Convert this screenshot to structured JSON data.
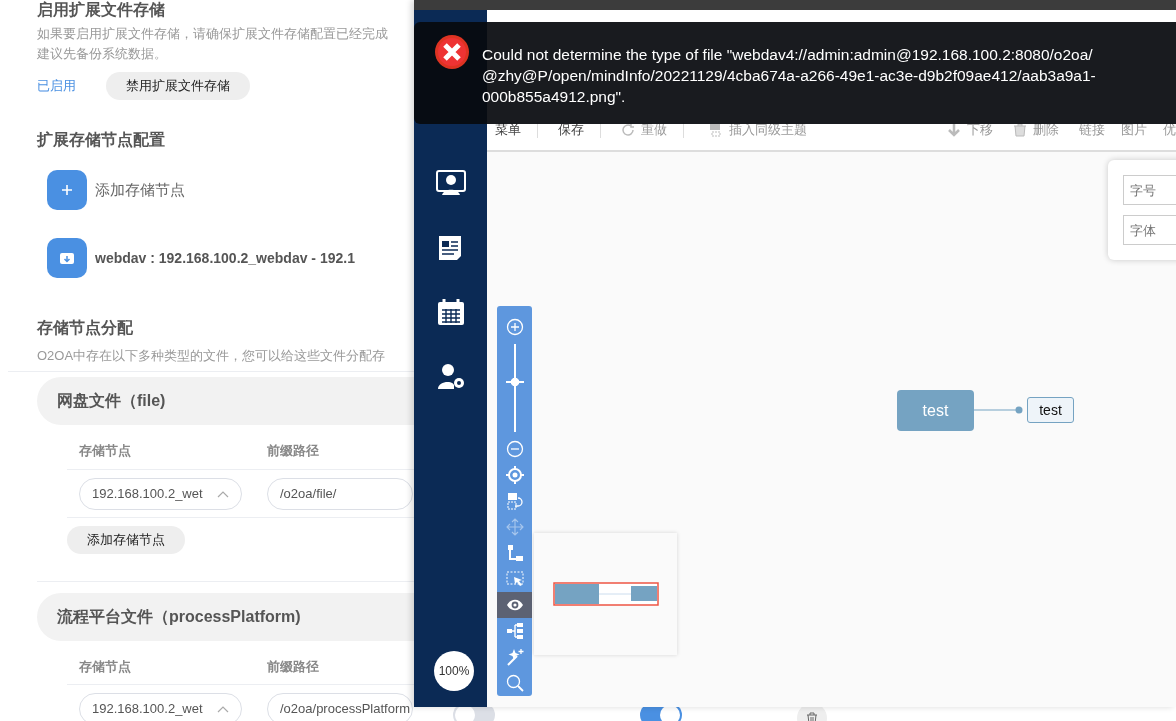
{
  "background_page": {
    "enable_section": {
      "title": "启用扩展文件存储",
      "description_lines": [
        "如果要启用扩展文件存储，请确保扩展文件存储配置已经完成",
        "建议先备份系统数据。"
      ],
      "status": "已启用",
      "button": "禁用扩展文件存储"
    },
    "node_config": {
      "title": "扩展存储节点配置",
      "add_label": "添加存储节点",
      "nodes": [
        "webdav : 192.168.100.2_webdav - 192.1"
      ]
    },
    "assignment": {
      "title": "存储节点分配",
      "description": "O2OA中存在以下多种类型的文件，您可以给这些文件分配存",
      "groups": [
        {
          "title": "网盘文件（file)",
          "columns": [
            "存储节点",
            "前缀路径"
          ],
          "rows": [
            {
              "node": "192.168.100.2_wet",
              "prefix": "/o2oa/file/"
            }
          ],
          "add_button": "添加存储节点"
        },
        {
          "title": "流程平台文件（processPlatform)",
          "columns": [
            "存储节点",
            "前缀路径"
          ],
          "rows": [
            {
              "node": "192.168.100.2_wet",
              "prefix": "/o2oa/processPlatform",
              "toggles": [
                {
                  "on": false
                },
                {
                  "on": true
                }
              ]
            }
          ]
        }
      ]
    }
  },
  "window": {
    "toolbar": [
      {
        "label": "菜单",
        "disabled": false
      },
      {
        "label": "保存",
        "disabled": false
      },
      {
        "label": "重做",
        "disabled": true
      },
      {
        "label": "插入同级主题",
        "disabled": true
      },
      {
        "label": "下移",
        "disabled": true
      },
      {
        "label": "删除",
        "disabled": true
      },
      {
        "label": "链接",
        "disabled": true
      },
      {
        "label": "图片",
        "disabled": true
      },
      {
        "label": "优",
        "disabled": true
      }
    ],
    "zoom_slider": {
      "level": 0.6
    },
    "zoom_tools": [
      {
        "selected": false,
        "disabled": false
      },
      {
        "selected": false,
        "disabled": false
      },
      {
        "selected": false,
        "disabled": false
      },
      {
        "selected": false,
        "disabled": false
      },
      {
        "selected": false,
        "disabled": true
      },
      {
        "selected": false,
        "disabled": false
      },
      {
        "selected": false,
        "disabled": false
      },
      {
        "selected": true,
        "disabled": false
      },
      {
        "selected": false,
        "disabled": false
      },
      {
        "selected": false,
        "disabled": false
      },
      {
        "selected": false,
        "disabled": false
      }
    ],
    "zoom_label": "100%",
    "mind_map": {
      "root": "test",
      "children": [
        "test"
      ]
    },
    "format_panel": {
      "fields": [
        {
          "placeholder": "字号"
        },
        {
          "placeholder": "字体"
        }
      ]
    },
    "error_toast": {
      "lines": [
        "Could not determine the type of file \"webdav4://admin:admin@192.168.100.2:8080/o2oa/",
        "@zhy@P/open/mindInfo/20221129/4cba674a-a266-49e1-ac3e-d9b2f09ae412/aab3a9a1-",
        "000b855a4912.png\"."
      ]
    }
  }
}
